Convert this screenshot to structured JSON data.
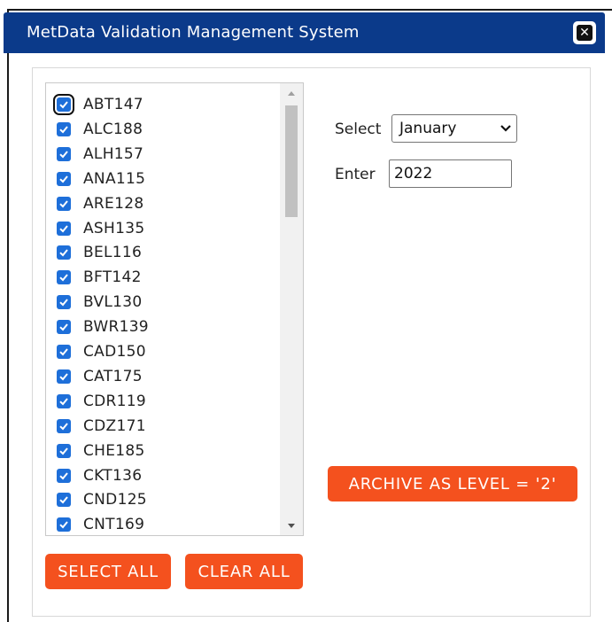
{
  "window": {
    "title": "MetData Validation Management System"
  },
  "stations": [
    "ABT147",
    "ALC188",
    "ALH157",
    "ANA115",
    "ARE128",
    "ASH135",
    "BEL116",
    "BFT142",
    "BVL130",
    "BWR139",
    "CAD150",
    "CAT175",
    "CDR119",
    "CDZ171",
    "CHE185",
    "CKT136",
    "CND125",
    "CNT169"
  ],
  "form": {
    "select_label": "Select",
    "month_value": "January",
    "enter_label": "Enter",
    "year_value": "2022"
  },
  "buttons": {
    "select_all": "SELECT ALL",
    "clear_all": "CLEAR ALL",
    "archive": "ARCHIVE AS LEVEL = '2'"
  },
  "colors": {
    "titlebar": "#0b3a8a",
    "button": "#f4511e",
    "checkbox": "#1e6fd9"
  }
}
